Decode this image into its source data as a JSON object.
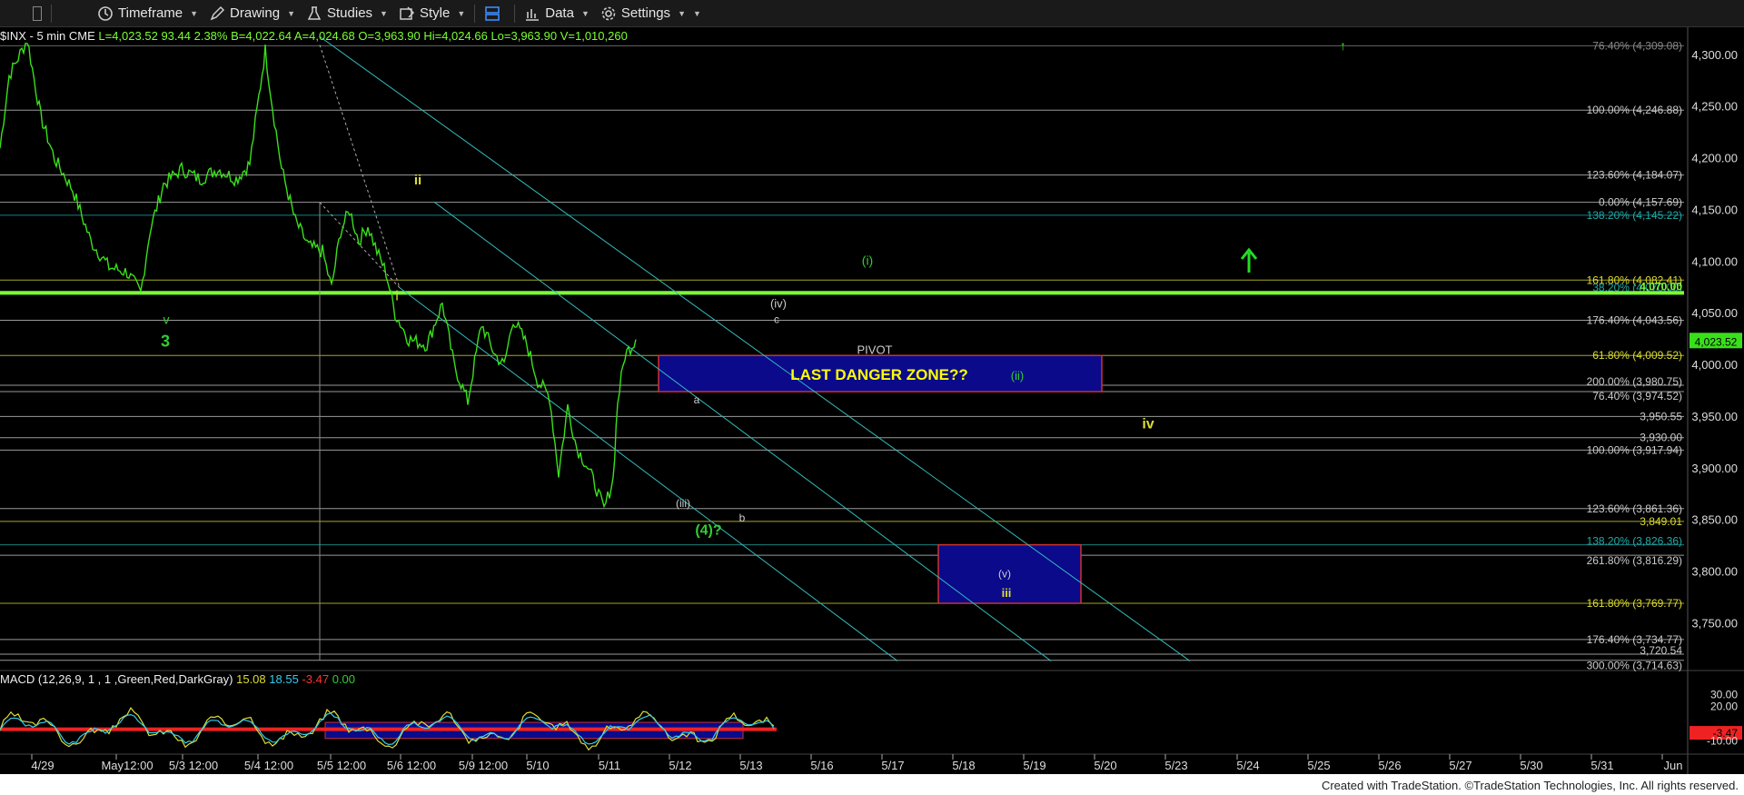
{
  "toolbar": {
    "timeframe": "Timeframe",
    "drawing": "Drawing",
    "studies": "Studies",
    "style": "Style",
    "data": "Data",
    "settings": "Settings"
  },
  "header": {
    "symbol": "$INX - 5 min  CME",
    "last": "L=4,023.52",
    "change": "93.44",
    "pct": "2.38%",
    "bid": "B=4,022.64",
    "ask": "A=4,024.68",
    "open": "O=3,963.90",
    "high": "Hi=4,024.66",
    "low": "Lo=3,963.90",
    "volume": "V=1,010,260"
  },
  "macd_header": {
    "name": "MACD (12,26,9, 1 , 1 ,Green,Red,DarkGray)",
    "v1": "15.08",
    "v2": "18.55",
    "v3": "-3.47",
    "v4": "0.00"
  },
  "chart_data": {
    "type": "line",
    "title": "$INX - 5 min",
    "ylim": [
      3710,
      4320
    ],
    "y_ticks": [
      "4,300.00",
      "4,250.00",
      "4,200.00",
      "4,150.00",
      "4,100.00",
      "4,050.00",
      "4,000.00",
      "3,950.00",
      "3,900.00",
      "3,850.00",
      "3,800.00",
      "3,750.00"
    ],
    "x_ticks": [
      "4/29",
      "May12:00",
      "5/3 12:00",
      "5/4 12:00",
      "5/5 12:00",
      "5/6 12:00",
      "5/9 12:00",
      "5/10",
      "5/11",
      "5/12",
      "5/13",
      "5/16",
      "5/17",
      "5/18",
      "5/19",
      "5/20",
      "5/23",
      "5/24",
      "5/25",
      "5/26",
      "5/27",
      "5/30",
      "5/31",
      "Jun"
    ],
    "last_price": "4,023.52",
    "price_series": [
      [
        0,
        4210
      ],
      [
        10,
        4280
      ],
      [
        30,
        4315
      ],
      [
        45,
        4240
      ],
      [
        60,
        4200
      ],
      [
        80,
        4170
      ],
      [
        100,
        4120
      ],
      [
        120,
        4095
      ],
      [
        140,
        4090
      ],
      [
        155,
        4070
      ],
      [
        165,
        4130
      ],
      [
        180,
        4175
      ],
      [
        200,
        4190
      ],
      [
        220,
        4180
      ],
      [
        240,
        4190
      ],
      [
        260,
        4180
      ],
      [
        275,
        4195
      ],
      [
        285,
        4260
      ],
      [
        292,
        4305
      ],
      [
        300,
        4250
      ],
      [
        310,
        4190
      ],
      [
        325,
        4140
      ],
      [
        340,
        4115
      ],
      [
        355,
        4110
      ],
      [
        365,
        4075
      ],
      [
        375,
        4130
      ],
      [
        385,
        4150
      ],
      [
        395,
        4120
      ],
      [
        405,
        4135
      ],
      [
        415,
        4110
      ],
      [
        425,
        4090
      ],
      [
        435,
        4050
      ],
      [
        450,
        4025
      ],
      [
        470,
        4020
      ],
      [
        487,
        4060
      ],
      [
        500,
        4000
      ],
      [
        515,
        3965
      ],
      [
        530,
        4040
      ],
      [
        545,
        4010
      ],
      [
        555,
        4000
      ],
      [
        565,
        4045
      ],
      [
        580,
        4020
      ],
      [
        592,
        3985
      ],
      [
        605,
        3970
      ],
      [
        615,
        3895
      ],
      [
        625,
        3960
      ],
      [
        635,
        3920
      ],
      [
        645,
        3905
      ],
      [
        655,
        3885
      ],
      [
        665,
        3860
      ],
      [
        675,
        3890
      ],
      [
        680,
        3965
      ],
      [
        688,
        4010
      ],
      [
        700,
        4025
      ]
    ],
    "horizontal_levels": [
      {
        "label": "76.40% (4,309.08)",
        "value": 4309.08,
        "color": "#888"
      },
      {
        "label": "100.00% (4,246.88)",
        "value": 4246.88,
        "color": "#ccc"
      },
      {
        "label": "123.60% (4,184.07)",
        "value": 4184.07,
        "color": "#ccc"
      },
      {
        "label": "0.00% (4,157.69)",
        "value": 4157.69,
        "color": "#ccc"
      },
      {
        "label": "138.20% (4,145.22)",
        "value": 4145.22,
        "color": "#2aa"
      },
      {
        "label": "161.80% (4,082.41)",
        "value": 4082.41,
        "color": "#dd3"
      },
      {
        "label": "38.20% (4,070.00)",
        "value": 4071.5,
        "color": "#2aa"
      },
      {
        "label": "4,070.00",
        "value": 4070.0,
        "color": "#7cff33"
      },
      {
        "label": "176.40% (4,043.56)",
        "value": 4043.56,
        "color": "#ccc"
      },
      {
        "label": "61.80% (4,009.52)",
        "value": 4009.52,
        "color": "#dd3"
      },
      {
        "label": "200.00% (3,980.75)",
        "value": 3980.75,
        "color": "#ccc"
      },
      {
        "label": "76.40% (3,974.52)",
        "value": 3974.52,
        "color": "#ccc"
      },
      {
        "label": "3,950.55",
        "value": 3950.55,
        "color": "#ccc"
      },
      {
        "label": "3,930.00",
        "value": 3930.0,
        "color": "#ccc"
      },
      {
        "label": "100.00% (3,917.94)",
        "value": 3917.94,
        "color": "#ccc"
      },
      {
        "label": "123.60% (3,861.36)",
        "value": 3861.36,
        "color": "#ccc"
      },
      {
        "label": "3,849.01",
        "value": 3849.01,
        "color": "#dd3"
      },
      {
        "label": "138.20% (3,826.36)",
        "value": 3826.36,
        "color": "#2aa"
      },
      {
        "label": "261.80% (3,816.29)",
        "value": 3816.29,
        "color": "#ccc"
      },
      {
        "label": "161.80% (3,769.77)",
        "value": 3769.77,
        "color": "#dd3"
      },
      {
        "label": "176.40% (3,734.77)",
        "value": 3734.77,
        "color": "#ccc"
      },
      {
        "label": "3,720.54",
        "value": 3720.54,
        "color": "#ccc"
      },
      {
        "label": "300.00% (3,714.63)",
        "value": 3714.63,
        "color": "#ccc"
      }
    ],
    "annotations": [
      {
        "text": "v",
        "color": "#3c3"
      },
      {
        "text": "3",
        "color": "#3c3"
      },
      {
        "text": "ii",
        "color": "#dd3"
      },
      {
        "text": "i",
        "color": "#dd3"
      },
      {
        "text": "(i)",
        "color": "#3c3"
      },
      {
        "text": "(iv)",
        "color": "#ccc"
      },
      {
        "text": "c",
        "color": "#ccc"
      },
      {
        "text": "PIVOT",
        "color": "#ccc"
      },
      {
        "text": "LAST DANGER ZONE??",
        "color": "#ff0"
      },
      {
        "text": "(ii)",
        "color": "#3c3"
      },
      {
        "text": "a",
        "color": "#ccc"
      },
      {
        "text": "iv",
        "color": "#dd3"
      },
      {
        "text": "(iii)",
        "color": "#ccc"
      },
      {
        "text": "b",
        "color": "#ccc"
      },
      {
        "text": "(4)?",
        "color": "#3c3"
      },
      {
        "text": "(v)",
        "color": "#ccc"
      },
      {
        "text": "iii",
        "color": "#dd3"
      }
    ],
    "macd": {
      "ylim": [
        -20,
        40
      ],
      "y_ticks": [
        "30.00",
        "20.00",
        "-3.47",
        "-10.00"
      ]
    }
  },
  "footer": "Created with TradeStation. ©TradeStation Technologies, Inc. All rights reserved."
}
